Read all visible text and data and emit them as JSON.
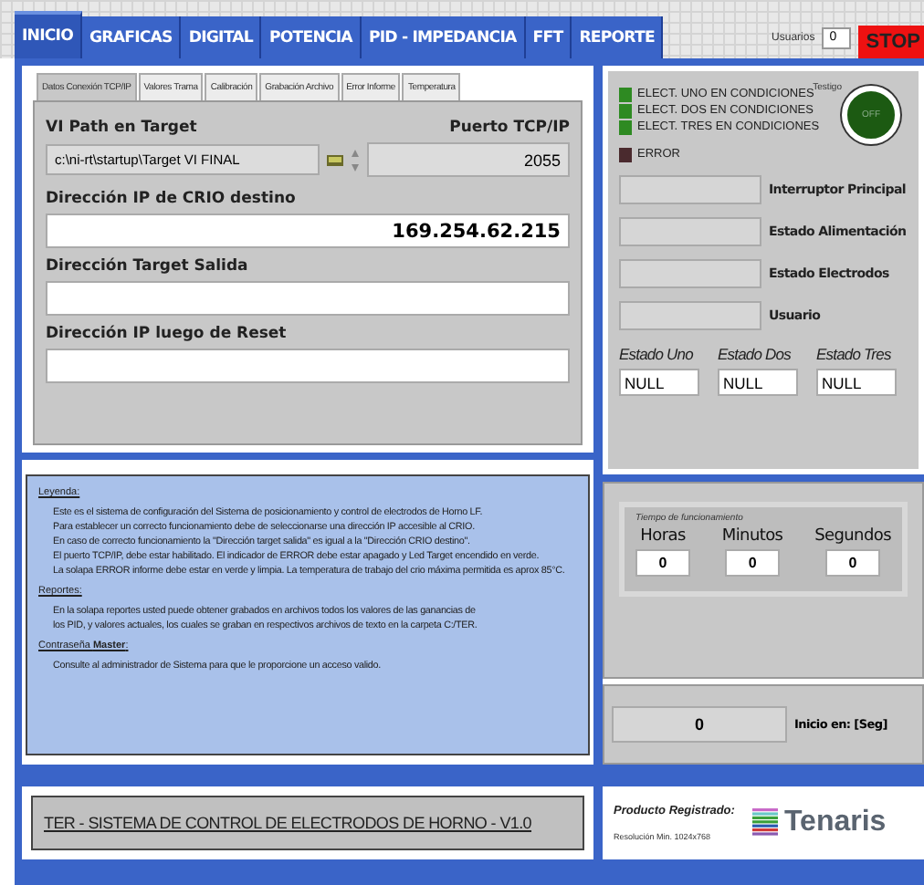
{
  "tabs": [
    {
      "label": "INICIO",
      "selected": true
    },
    {
      "label": "GRAFICAS",
      "selected": false
    },
    {
      "label": "DIGITAL",
      "selected": false
    },
    {
      "label": "POTENCIA",
      "selected": false
    },
    {
      "label": "PID - IMPEDANCIA",
      "selected": false
    },
    {
      "label": "FFT",
      "selected": false
    },
    {
      "label": "REPORTE",
      "selected": false
    }
  ],
  "users": {
    "label": "Usuarios",
    "value": "0"
  },
  "stop_button": "STOP",
  "sub_tabs": [
    {
      "label": "Datos Conexión TCP/IP",
      "selected": true
    },
    {
      "label": "Valores Trama",
      "selected": false
    },
    {
      "label": "Calibración",
      "selected": false
    },
    {
      "label": "Grabación Archivo",
      "selected": false
    },
    {
      "label": "Error Informe",
      "selected": false
    },
    {
      "label": "Temperatura",
      "selected": false
    }
  ],
  "connection": {
    "vi_path_label": "VI Path en Target",
    "vi_path": "c:\\ni-rt\\startup\\Target VI FINAL",
    "port_label": "Puerto TCP/IP",
    "port": "2055",
    "fields": [
      {
        "label": "Dirección IP de CRIO destino",
        "value": "169.254.62.215"
      },
      {
        "label": "Dirección Target Salida"
      },
      {
        "label": "Dirección IP luego de Reset"
      }
    ]
  },
  "indicators": [
    {
      "label": "ELECT. UNO EN CONDICIONES",
      "on": true
    },
    {
      "label": "ELECT. DOS EN CONDICIONES",
      "on": true
    },
    {
      "label": "ELECT. TRES EN CONDICIONES",
      "on": true
    }
  ],
  "error_indicator": {
    "label": "ERROR",
    "on": false
  },
  "testigo": {
    "label": "Testigo",
    "text": "OFF",
    "on": false
  },
  "status_fields": [
    {
      "label": "Interruptor Principal"
    },
    {
      "label": "Estado Alimentación"
    },
    {
      "label": "Estado Electrodos"
    },
    {
      "label": "Usuario"
    }
  ],
  "states": [
    {
      "label": "Estado Uno",
      "value": "NULL"
    },
    {
      "label": "Estado Dos",
      "value": "NULL"
    },
    {
      "label": "Estado Tres",
      "value": "NULL"
    }
  ],
  "legend": [
    {
      "heading": "Leyenda:",
      "lines": [
        "Este es el sistema de configuración del Sistema de posicionamiento y control de electrodos de Horno LF.",
        "Para establecer un correcto funcionamiento debe de seleccionarse una dirección IP accesible al CRIO.",
        "En caso de correcto funcionamiento la \"Dirección target salida\" es igual a la \"Dirección CRIO destino\".",
        "El puerto TCP/IP, debe estar habilitado.  El indicador de ERROR debe estar apagado y Led Target encendido en verde.",
        "La solapa ERROR informe debe estar en verde y limpia. La temperatura de trabajo del crio máxima permitida es aprox 85°C."
      ]
    },
    {
      "heading": "Reportes:",
      "lines": [
        "En la solapa reportes usted puede obtener grabados en archivos todos los valores de las ganancias de",
        "los PID, y valores actuales, los cuales se graban en respectivos archivos de texto en la carpeta C:/TER."
      ]
    },
    {
      "heading": "Contraseña **Master**:",
      "lines": [
        "Consulte al administrador de Sistema para que le proporcione un acceso valido."
      ]
    }
  ],
  "timer": {
    "title": "Tiempo de funcionamiento",
    "units": [
      {
        "label": "Horas",
        "value": "0"
      },
      {
        "label": "Minutos",
        "value": "0"
      },
      {
        "label": "Segundos",
        "value": "0"
      }
    ]
  },
  "start": {
    "value": "0",
    "label": "Inicio en: [Seg]"
  },
  "footer": {
    "title": "TER - SISTEMA DE CONTROL DE ELECTRODOS DE HORNO - V1.0",
    "registered": "Producto Registrado:",
    "resolution": "Resolución Min. 1024x768",
    "brand": "Tenaris"
  }
}
